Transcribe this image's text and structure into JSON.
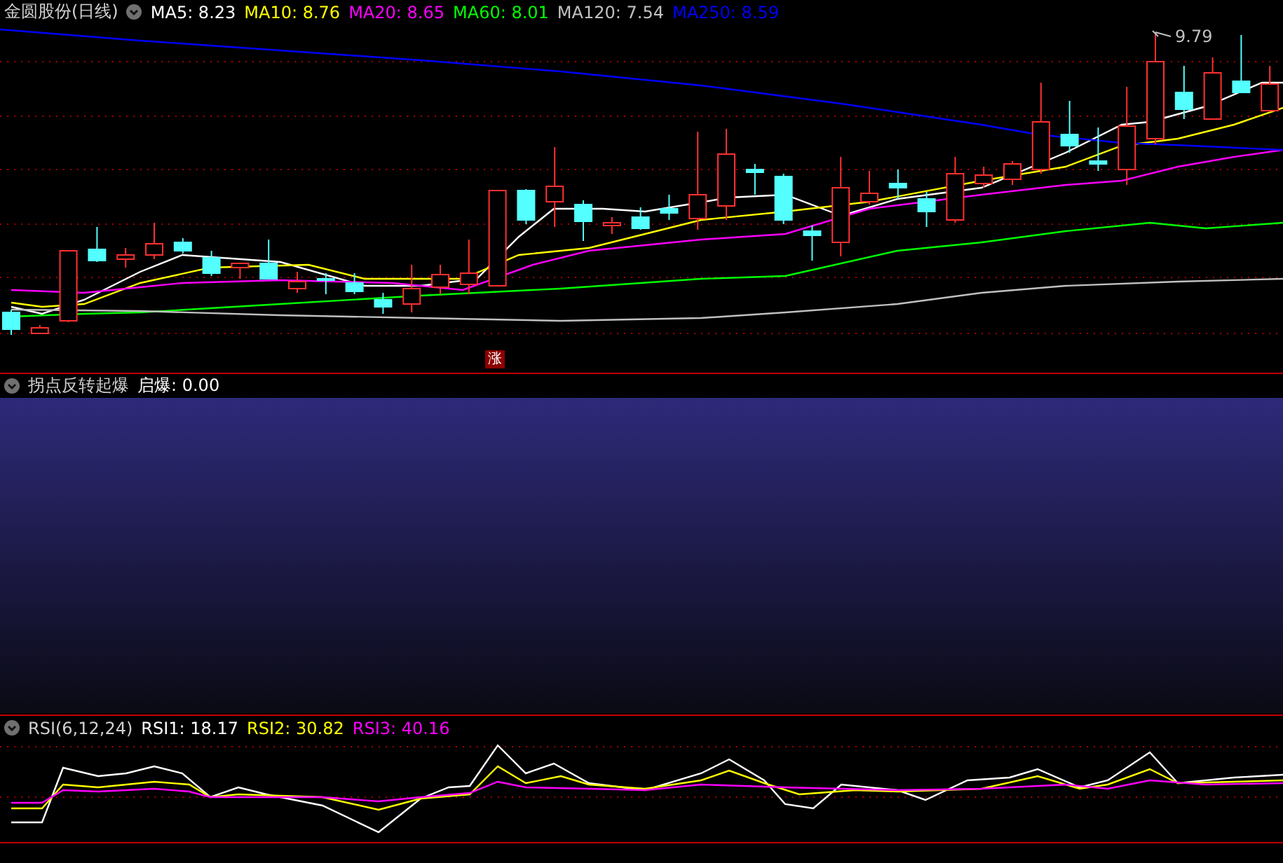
{
  "price_panel": {
    "title": "金圆股份(日线)",
    "indicators": [
      {
        "label": "MA5: 8.23",
        "color": "#ffffff"
      },
      {
        "label": "MA10: 8.76",
        "color": "#ffff00"
      },
      {
        "label": "MA20: 8.65",
        "color": "#ff00ff"
      },
      {
        "label": "MA60: 8.01",
        "color": "#00ff00"
      },
      {
        "label": "MA120: 7.54",
        "color": "#c0c0c0"
      },
      {
        "label": "MA250: 8.59",
        "color": "#0000ff"
      }
    ],
    "high_label": "9.79",
    "badge": "涨"
  },
  "signal_panel": {
    "title": "拐点反转起爆",
    "indicators": [
      {
        "label": "启爆: 0.00"
      }
    ]
  },
  "rsi_panel": {
    "title": "RSI(6,12,24)",
    "indicators": [
      {
        "label": "RSI1: 18.17",
        "color": "#ffffff"
      },
      {
        "label": "RSI2: 30.82",
        "color": "#ffff00"
      },
      {
        "label": "RSI3: 40.16",
        "color": "#ff00ff"
      }
    ]
  }
}
